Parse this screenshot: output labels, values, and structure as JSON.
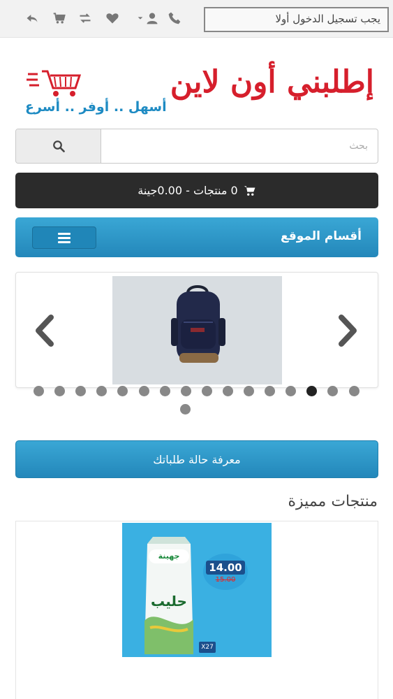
{
  "topbar": {
    "login_notice": "يجب تسجيل الدخول أولا",
    "icons": [
      "back-icon",
      "cart-icon",
      "compare-icon",
      "heart-icon",
      "user-icon",
      "phone-icon"
    ]
  },
  "logo": {
    "main_text": "إطلبني أون لاين",
    "tagline": "أسهل .. أوفر .. أسرع"
  },
  "search": {
    "placeholder": "بحث",
    "value": ""
  },
  "cart": {
    "label": "0 منتجات - 0.00جينة"
  },
  "categories": {
    "label": "أقسام الموقع"
  },
  "carousel": {
    "slide_count": 17,
    "active_index": 13,
    "slide_subject": "backpack"
  },
  "order_status": {
    "label": "معرفة حالة طلباتك"
  },
  "featured": {
    "title": "منتجات مميزة",
    "product": {
      "brand": "جهينة",
      "name": "حليب",
      "price": "14.00",
      "old_price": "15.00",
      "pack": "X27"
    }
  },
  "colors": {
    "accent_blue": "#2a96c9",
    "cart_bar": "#2b2b2b",
    "logo_red": "#d61f2c",
    "logo_blue": "#1e8bc3"
  }
}
